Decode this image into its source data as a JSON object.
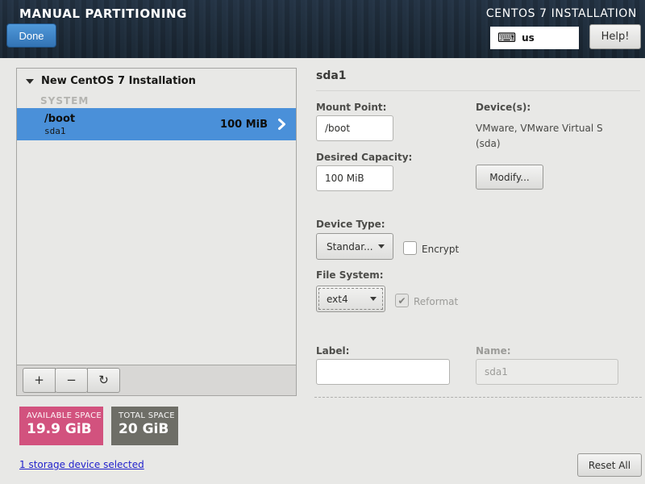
{
  "header": {
    "title": "MANUAL PARTITIONING",
    "product_title": "CENTOS 7 INSTALLATION",
    "done_button": "Done",
    "keyboard_layout": "us",
    "help_button": "Help!"
  },
  "sidebar": {
    "root_item": "New CentOS 7 Installation",
    "group_header": "SYSTEM",
    "partitions": [
      {
        "mount_point": "/boot",
        "device_name": "sda1",
        "size": "100 MiB",
        "selected": true
      }
    ],
    "toolbar": {
      "add": "+",
      "remove": "−",
      "reload": "↻"
    }
  },
  "space": {
    "available_label": "AVAILABLE SPACE",
    "available_value": "19.9 GiB",
    "total_label": "TOTAL SPACE",
    "total_value": "20 GiB"
  },
  "footer": {
    "selected_link": "1 storage device selected",
    "reset_button": "Reset All"
  },
  "details": {
    "title": "sda1",
    "mount_point_label": "Mount Point:",
    "mount_point_value": "/boot",
    "capacity_label": "Desired Capacity:",
    "capacity_value": "100 MiB",
    "devices_label": "Device(s):",
    "devices_value": "VMware, VMware Virtual S (sda)",
    "modify_button": "Modify...",
    "device_type_label": "Device Type:",
    "device_type_value": "Standar...",
    "encrypt_label": "Encrypt",
    "encrypt_checked": false,
    "file_system_label": "File System:",
    "file_system_value": "ext4",
    "reformat_label": "Reformat",
    "reformat_checked": true,
    "check_glyph": "✔",
    "label_label": "Label:",
    "label_value": "",
    "name_label": "Name:",
    "name_value": "sda1"
  },
  "colors": {
    "header_bg": "#1b2733",
    "selection_blue": "#4a90d9",
    "available_pink": "#d2527e",
    "total_gray": "#6e6e67",
    "link_blue": "#2121cc",
    "done_button_blue": "#3c82c5"
  }
}
